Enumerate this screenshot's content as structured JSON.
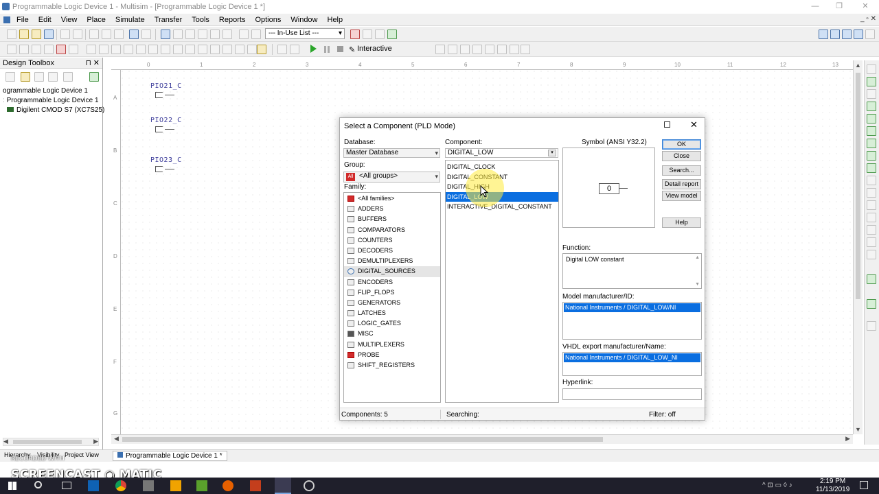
{
  "window": {
    "title": "Programmable Logic Device 1 - Multisim - [Programmable Logic Device 1 *]"
  },
  "menu": [
    "File",
    "Edit",
    "View",
    "Place",
    "Simulate",
    "Transfer",
    "Tools",
    "Reports",
    "Options",
    "Window",
    "Help"
  ],
  "toolbar": {
    "inuse_list": "--- In-Use List ---",
    "interactive": "Interactive"
  },
  "toolbox": {
    "title": "Design Toolbox",
    "tree": [
      "ogrammable Logic Device 1",
      "Programmable Logic Device 1",
      "Digilent CMOD S7 (XC7S25)"
    ]
  },
  "ruler": {
    "top": [
      "0",
      "1",
      "2",
      "3",
      "4",
      "5",
      "6",
      "7",
      "8",
      "9",
      "10",
      "11",
      "12",
      "13"
    ],
    "left": [
      "A",
      "B",
      "C",
      "D",
      "E",
      "F",
      "G"
    ]
  },
  "schematic": {
    "pins": [
      "PIO21_C",
      "PIO22_C",
      "PIO23_C"
    ]
  },
  "dialog": {
    "title": "Select a Component (PLD Mode)",
    "database_label": "Database:",
    "database_value": "Master Database",
    "group_label": "Group:",
    "group_value": "<All groups>",
    "family_label": "Family:",
    "families": [
      "<All families>",
      "ADDERS",
      "BUFFERS",
      "COMPARATORS",
      "COUNTERS",
      "DECODERS",
      "DEMULTIPLEXERS",
      "DIGITAL_SOURCES",
      "ENCODERS",
      "FLIP_FLOPS",
      "GENERATORS",
      "LATCHES",
      "LOGIC_GATES",
      "MISC",
      "MULTIPLEXERS",
      "PROBE",
      "SHIFT_REGISTERS"
    ],
    "selected_family": "DIGITAL_SOURCES",
    "component_label": "Component:",
    "component_value": "DIGITAL_LOW",
    "components": [
      "DIGITAL_CLOCK",
      "DIGITAL_CONSTANT",
      "DIGITAL_HIGH",
      "DIGITAL_LOW",
      "INTERACTIVE_DIGITAL_CONSTANT"
    ],
    "selected_component": "DIGITAL_LOW",
    "symbol_label": "Symbol (ANSI Y32.2)",
    "symbol_value": "0",
    "buttons": {
      "ok": "OK",
      "close": "Close",
      "search": "Search...",
      "detail": "Detail report",
      "view_model": "View model",
      "help": "Help"
    },
    "function_label": "Function:",
    "function_value": "Digital LOW constant",
    "model_label": "Model manufacturer/ID:",
    "model_value": "National Instruments / DIGITAL_LOW/NI",
    "vhdl_label": "VHDL export manufacturer/Name:",
    "vhdl_value": "National Instruments / DIGITAL_LOW_NI",
    "hyperlink_label": "Hyperlink:",
    "status_components": "Components: 5",
    "status_searching": "Searching:",
    "status_filter": "Filter: off"
  },
  "bottom_tabs": [
    "Hierarchy",
    "Visibility",
    "Project View"
  ],
  "document_tab": "Programmable Logic Device 1 *",
  "overlay": {
    "recorded": "RECORDED WITH",
    "brand": "SCREENCAST ◉ MATIC"
  },
  "clock": {
    "time": "2:19 PM",
    "date": "11/13/2019"
  }
}
